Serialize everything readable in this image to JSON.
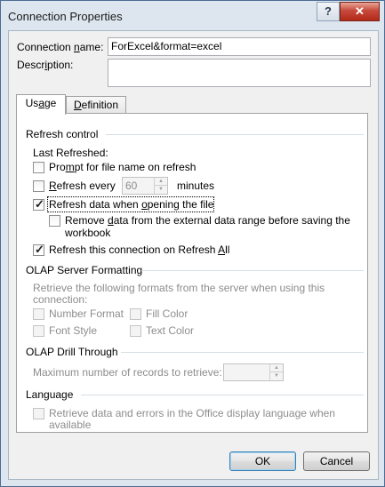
{
  "window": {
    "title": "Connection Properties",
    "help_label": "?",
    "close_label": "✕"
  },
  "connection": {
    "name_label_pre": "Connection ",
    "name_label_key": "n",
    "name_label_post": "ame:",
    "name_value": "ForExcel&format=excel",
    "description_label_pre": "Descr",
    "description_label_key": "i",
    "description_label_post": "ption:",
    "description_value": ""
  },
  "tabs": [
    {
      "label_pre": "Us",
      "label_key": "a",
      "label_post": "ge",
      "active": true
    },
    {
      "label_pre": "",
      "label_key": "D",
      "label_post": "efinition",
      "active": false
    }
  ],
  "usage": {
    "refresh_control": {
      "title": "Refresh control",
      "last_refreshed_label": "Last Refreshed:",
      "prompt_pre": "Pro",
      "prompt_key": "m",
      "prompt_post": "pt for file name on refresh",
      "prompt_checked": false,
      "refresh_every_pre": "",
      "refresh_every_key": "R",
      "refresh_every_post": "efresh every",
      "refresh_every_checked": false,
      "refresh_every_value": "60",
      "minutes_label": "minutes",
      "refresh_open_pre": "Refresh data when ",
      "refresh_open_key": "o",
      "refresh_open_post": "pening the file",
      "refresh_open_checked": true,
      "remove_pre": "Remove ",
      "remove_key": "d",
      "remove_post": "ata from the external data range before saving the",
      "remove_line2": "workbook",
      "remove_checked": false,
      "refresh_all_pre": "Refresh this connection on Refresh ",
      "refresh_all_key": "A",
      "refresh_all_post": "ll",
      "refresh_all_checked": true
    },
    "olap_formatting": {
      "title": "OLAP Server Formatting",
      "description_line1": "Retrieve the following formats from the server when using this",
      "description_line2": "connection:",
      "number_format": "Number Format",
      "fill_color": "Fill Color",
      "font_style": "Font Style",
      "text_color": "Text Color"
    },
    "olap_drill": {
      "title": "OLAP Drill Through",
      "max_records_label": "Maximum number of records to retrieve:",
      "max_records_value": ""
    },
    "language": {
      "title": "Language",
      "retrieve_line1": "Retrieve data and errors in the Office display language when",
      "retrieve_line2": "available"
    }
  },
  "buttons": {
    "ok": "OK",
    "cancel": "Cancel"
  }
}
